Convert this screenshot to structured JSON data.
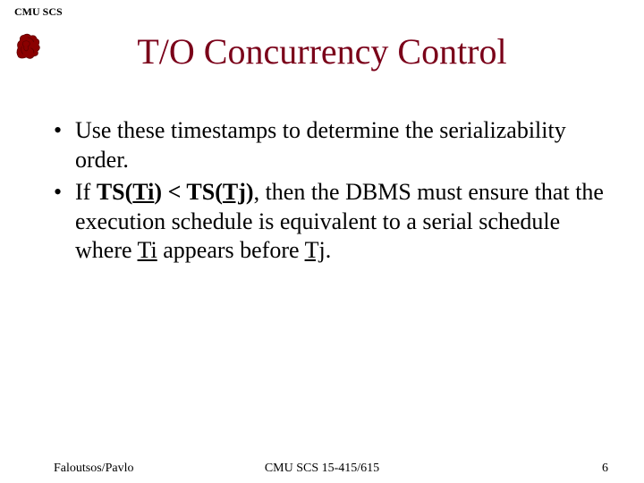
{
  "header": {
    "label": "CMU SCS"
  },
  "title": "T/O Concurrency Control",
  "bullets": [
    {
      "text": "Use these timestamps to determine the serializability order."
    },
    {
      "prefix": "If ",
      "ts1": "TS(",
      "ti": "Ti",
      "ts1_close": ") < ",
      "ts2": "TS(",
      "tj": "Tj",
      "ts2_close": ")",
      "mid": ", then the DBMS must ensure that the execution schedule is equivalent to a serial schedule where ",
      "ti2": "Ti",
      "mid2": " appears before ",
      "tj2": "Tj",
      "end": "."
    }
  ],
  "footer": {
    "left": "Faloutsos/Pavlo",
    "center": "CMU SCS 15-415/615",
    "right": "6"
  }
}
